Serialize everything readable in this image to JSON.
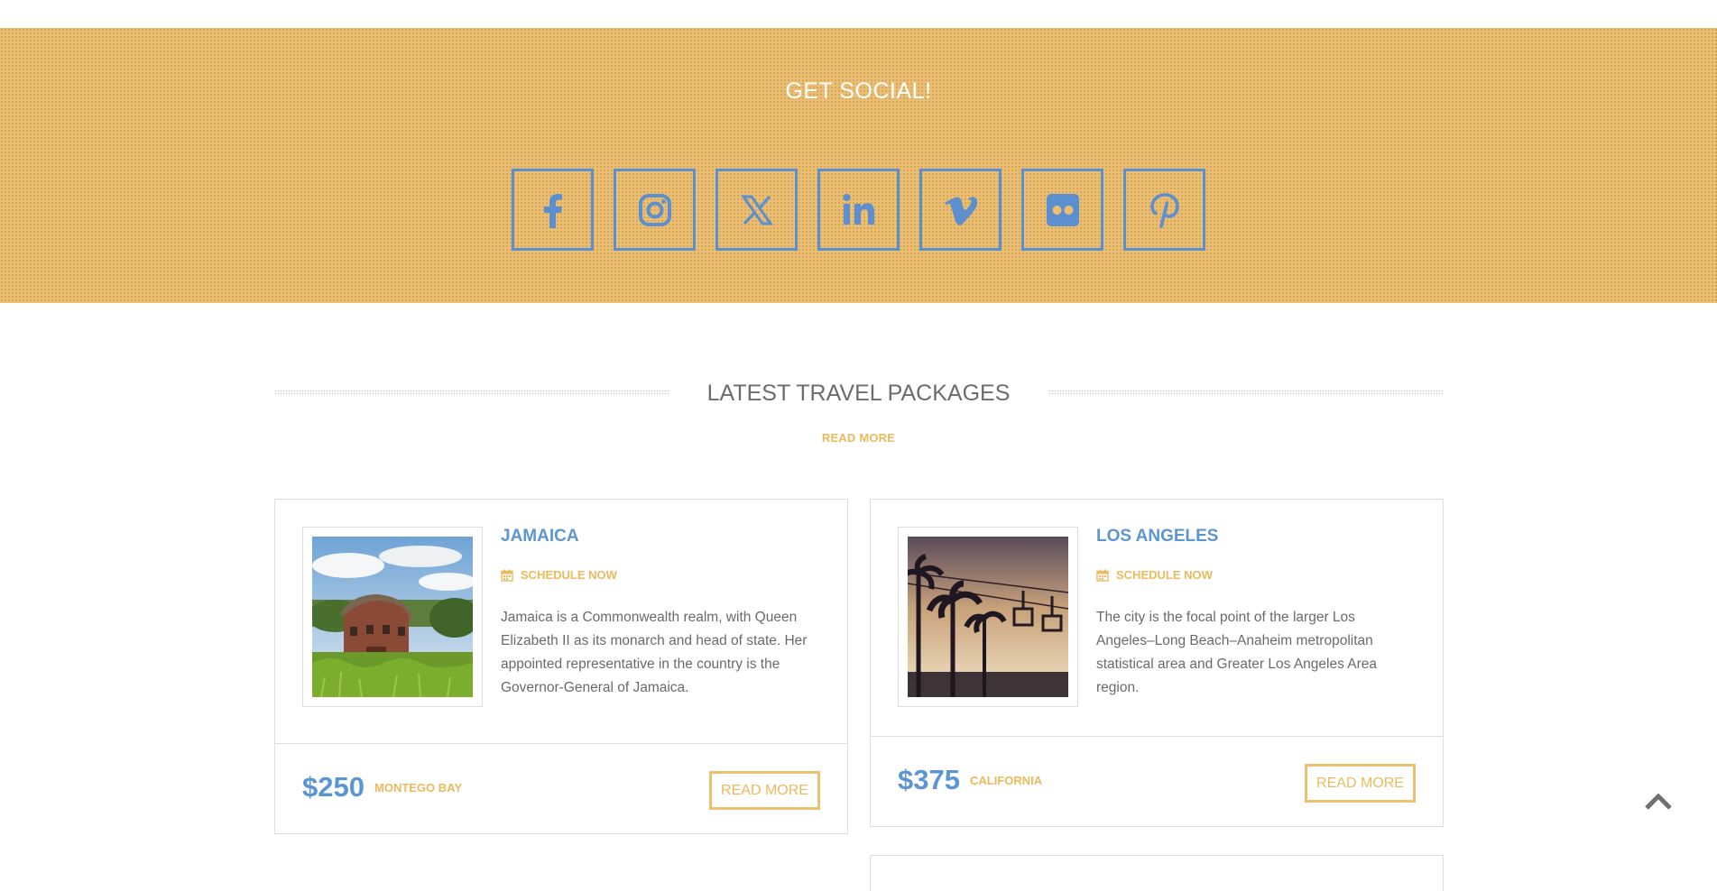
{
  "social": {
    "title": "GET SOCIAL!",
    "icons": [
      "facebook-icon",
      "instagram-icon",
      "x-twitter-icon",
      "linkedin-icon",
      "vimeo-icon",
      "flickr-icon",
      "pinterest-icon"
    ]
  },
  "section": {
    "title": "LATEST TRAVEL PACKAGES",
    "read_more": "READ MORE"
  },
  "packages": [
    {
      "title": "JAMAICA",
      "schedule": "SCHEDULE NOW",
      "description": "Jamaica is a Commonwealth realm, with Queen Elizabeth II as its monarch and head of state. Her appointed representative in the country is the Governor-General of Jamaica.",
      "price": "$250",
      "location": "MONTEGO BAY",
      "button": "READ MORE",
      "image": "barn-photo"
    },
    {
      "title": "LOS ANGELES",
      "schedule": "SCHEDULE NOW",
      "description": "The city is the focal point of the larger Los Angeles–Long Beach–Anaheim metropolitan statistical area and Greater Los Angeles Area region.",
      "price": "$375",
      "location": "CALIFORNIA",
      "button": "READ MORE",
      "image": "palm-trees-chairlift-photo"
    }
  ],
  "colors": {
    "accent_blue": "#5b96d2",
    "accent_gold": "#ecb95c",
    "band": "#ecbe72"
  },
  "back_to_top": "chevron-up-icon"
}
